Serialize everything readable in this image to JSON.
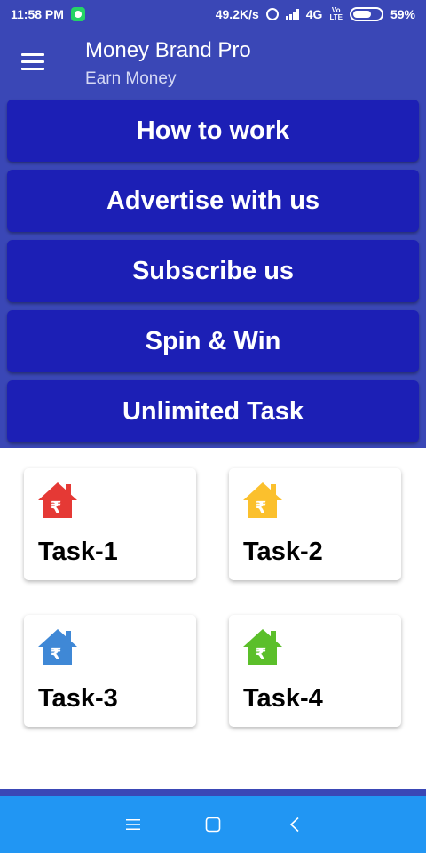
{
  "status_bar": {
    "time": "11:58 PM",
    "net_speed": "49.2K/s",
    "network": "4G",
    "volte": "Vo\nLTE",
    "battery": "59%"
  },
  "app_bar": {
    "title": "Money Brand Pro",
    "subtitle": "Earn Money"
  },
  "menu_buttons": [
    {
      "label": "How to work"
    },
    {
      "label": "Advertise with us"
    },
    {
      "label": "Subscribe us"
    },
    {
      "label": "Spin & Win"
    },
    {
      "label": "Unlimited Task"
    }
  ],
  "tasks": [
    {
      "label": "Task-1",
      "icon_color": "#e53935"
    },
    {
      "label": "Task-2",
      "icon_color": "#fbc02d"
    },
    {
      "label": "Task-3",
      "icon_color": "#3f88d6"
    },
    {
      "label": "Task-4",
      "icon_color": "#5bbf2a"
    }
  ],
  "icons": {
    "currency_glyph": "₹",
    "house": "house-rupee-icon",
    "menu": "hamburger-menu-icon"
  },
  "colors": {
    "primary": "#3a47b6",
    "button": "#1c1fb5",
    "nav_bar": "#2196f3"
  }
}
